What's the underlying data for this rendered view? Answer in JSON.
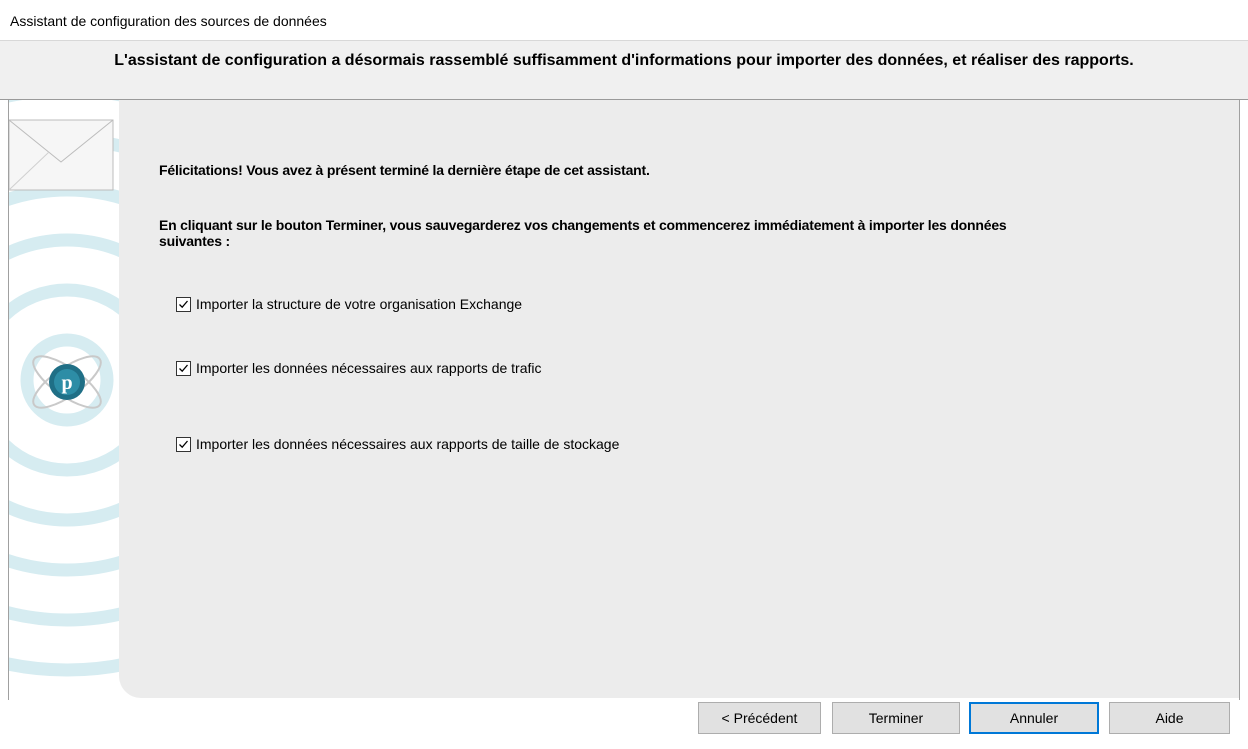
{
  "window": {
    "title": "Assistant de configuration des sources de données"
  },
  "header": {
    "text": "L'assistant de configuration a désormais rassemblé suffisamment d'informations pour importer des données, et réaliser des rapports."
  },
  "content": {
    "congrats": "Félicitations! Vous avez à présent terminé la dernière étape de cet assistant.",
    "info": "En cliquant sur le bouton Terminer, vous sauvegarderez vos changements et commencerez immédiatement à importer les données suivantes :",
    "options": [
      {
        "label": "Importer la structure de votre organisation Exchange",
        "checked": true
      },
      {
        "label": "Importer les données nécessaires aux rapports de trafic",
        "checked": true
      },
      {
        "label": "Importer les données nécessaires aux rapports de taille de stockage",
        "checked": true
      }
    ]
  },
  "buttons": {
    "previous": "< Précédent",
    "finish": "Terminer",
    "cancel": "Annuler",
    "help": "Aide"
  },
  "colors": {
    "accent": "#0078d7",
    "panel": "#ececec",
    "art_ring": "#d6ecf1"
  },
  "side_art": {
    "top_icon": "envelope-icon",
    "logo_icon": "orbit-logo-icon"
  }
}
